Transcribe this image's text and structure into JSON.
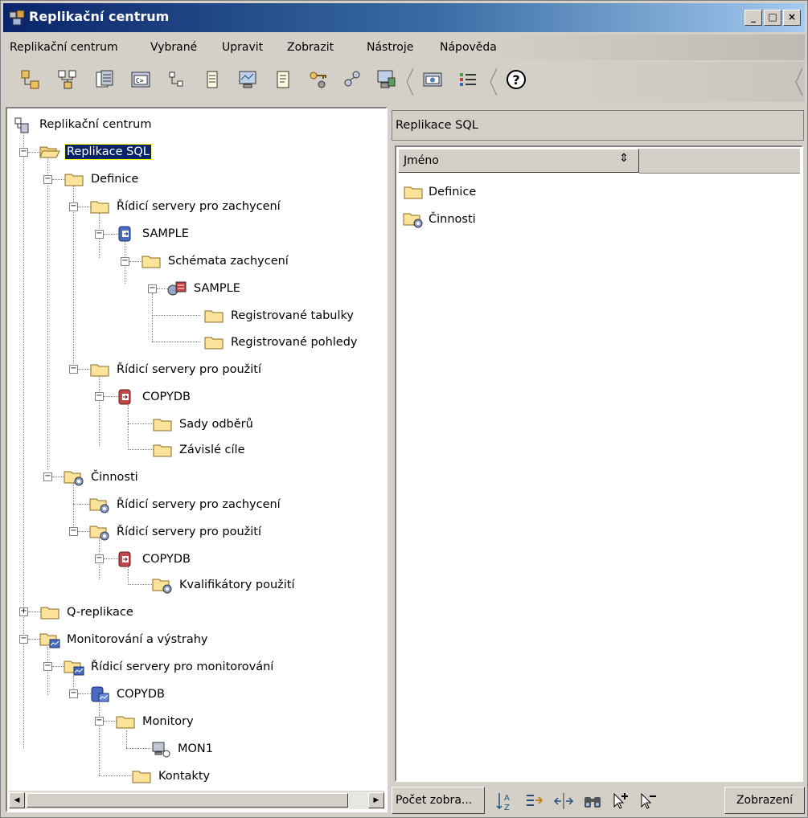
{
  "window": {
    "title": "Replikační centrum"
  },
  "menu": [
    "Replikační centrum",
    "Vybrané",
    "Upravit",
    "Zobrazit",
    "Nástroje",
    "Nápověda"
  ],
  "tree": {
    "root": "Replikační centrum",
    "sql": "Replikace SQL",
    "definice": "Definice",
    "capture_servers": "Řídicí servery pro zachycení",
    "sample_db": "SAMPLE",
    "capture_schemas": "Schémata zachycení",
    "sample_schema": "SAMPLE",
    "reg_tables": "Registrované tabulky",
    "reg_views": "Registrované pohledy",
    "apply_servers": "Řídicí servery pro použití",
    "copydb1": "COPYDB",
    "subscription_sets": "Sady odběrů",
    "dependent_targets": "Závislé cíle",
    "cinnosti": "Činnosti",
    "ops_capture": "Řídicí servery pro zachycení",
    "ops_apply": "Řídicí servery pro použití",
    "copydb2": "COPYDB",
    "apply_qualifiers": "Kvalifikátory použití",
    "q_replication": "Q-replikace",
    "monitoring": "Monitorování a výstrahy",
    "monitor_servers": "Řídicí servery pro monitorování",
    "copydb3": "COPYDB",
    "monitors": "Monitory",
    "mon1": "MON1",
    "contacts": "Kontakty"
  },
  "right": {
    "title": "Replikace SQL",
    "column_name": "Jméno",
    "items": [
      "Definice",
      "Činnosti"
    ]
  },
  "bottom": {
    "count_label": "Počet zobra...",
    "view_label": "Zobrazení"
  }
}
